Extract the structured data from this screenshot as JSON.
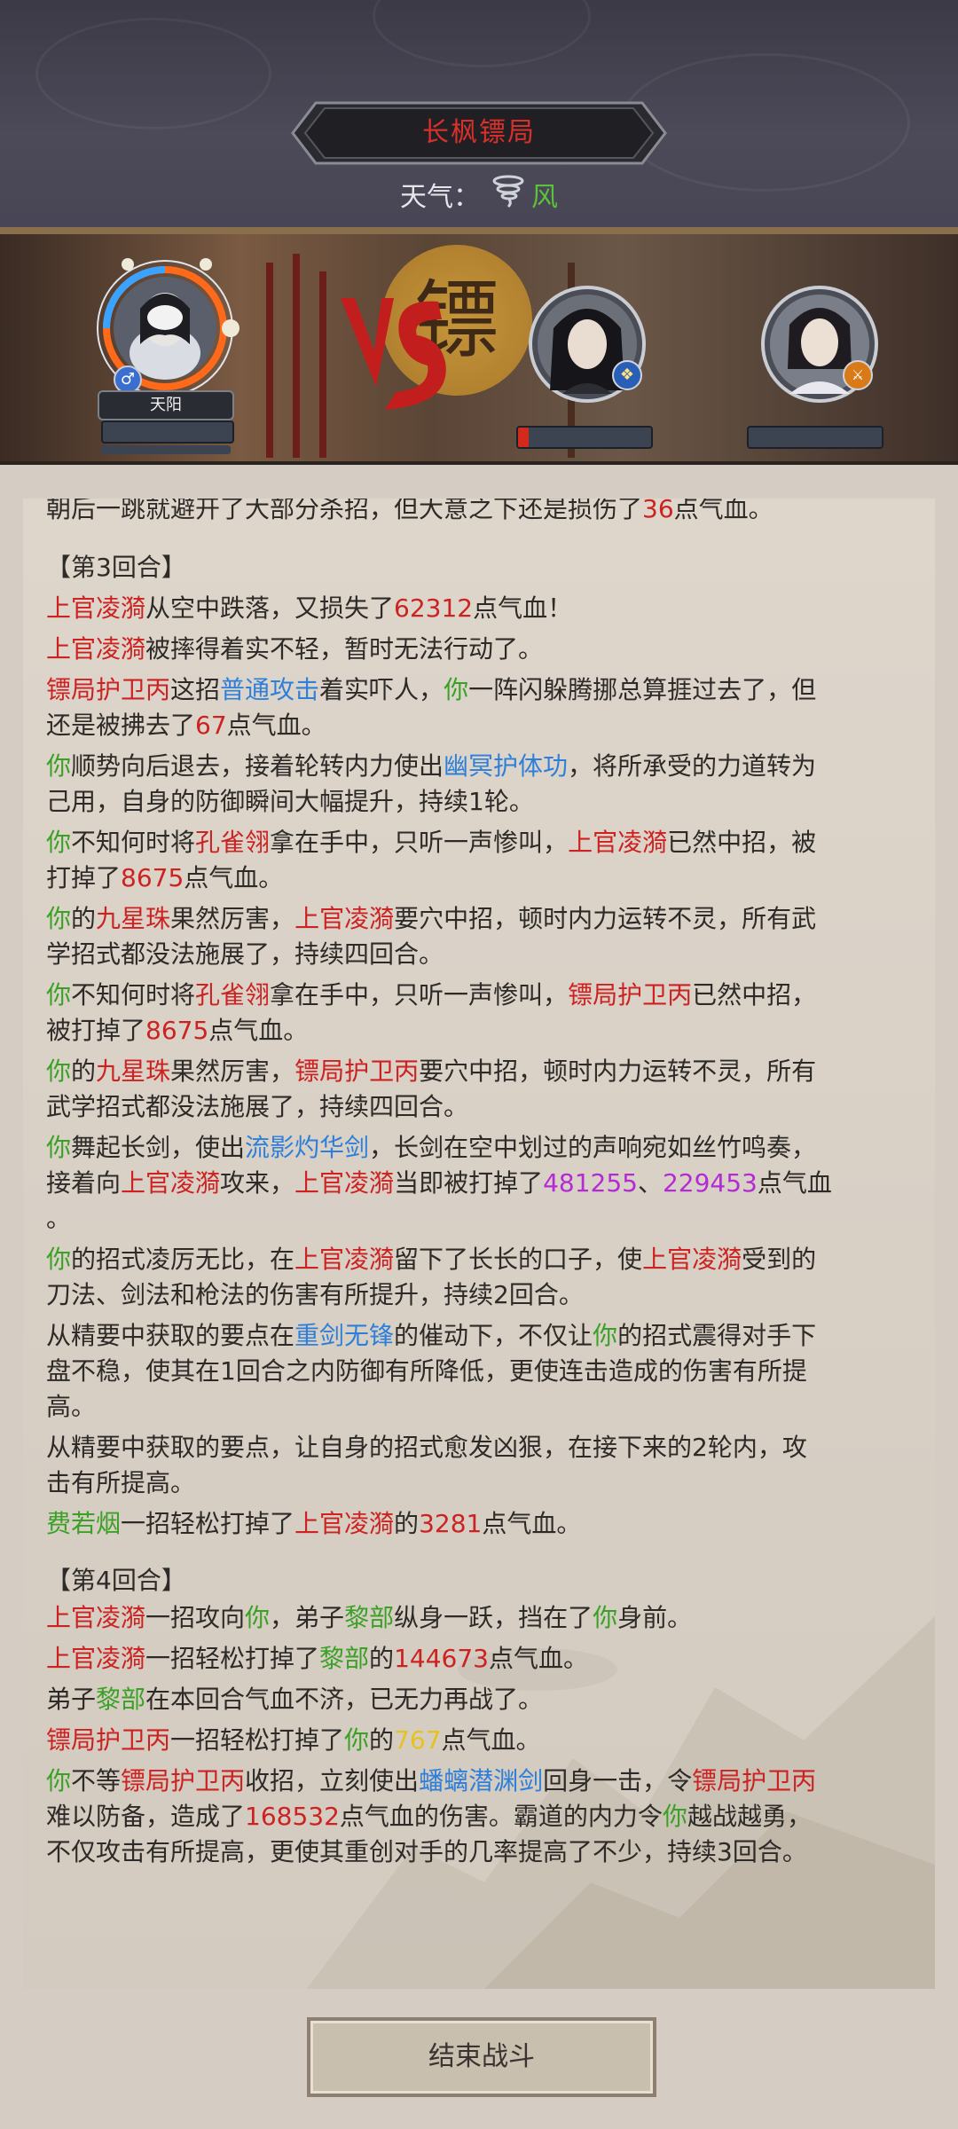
{
  "header": {
    "title": "长枫镖局",
    "weather_label": "天气：",
    "weather_value": "风",
    "weather_icon": "whirlwind-icon"
  },
  "battle": {
    "player_name": "天阳",
    "vs_label": "VS",
    "sign_char": "镖",
    "enemy1_hp_fraction": 0.08,
    "enemy2_hp_fraction": 0.0
  },
  "log": {
    "lines": [
      [
        {
          "t": "朝后一跳就避开了大部分杀招，但大意之下还是损伤了",
          "c": ""
        },
        {
          "t": "36",
          "c": "r"
        },
        {
          "t": "点气血。",
          "c": ""
        }
      ],
      [
        {
          "t": "【第3回合】",
          "c": ""
        }
      ],
      [
        {
          "t": "上官凌漪",
          "c": "r"
        },
        {
          "t": "从空中跌落，又损失了",
          "c": ""
        },
        {
          "t": "62312",
          "c": "r"
        },
        {
          "t": "点气血！",
          "c": ""
        }
      ],
      [
        {
          "t": "上官凌漪",
          "c": "r"
        },
        {
          "t": "被摔得着实不轻，暂时无法行动了。",
          "c": ""
        }
      ],
      [
        {
          "t": "镖局护卫丙",
          "c": "r"
        },
        {
          "t": "这招",
          "c": ""
        },
        {
          "t": "普通攻击",
          "c": "b"
        },
        {
          "t": "着实吓人，",
          "c": ""
        },
        {
          "t": "你",
          "c": "g"
        },
        {
          "t": "一阵闪躲腾挪总算捱过去了，但",
          "c": ""
        }
      ],
      [
        {
          "t": "还是被拂去了",
          "c": ""
        },
        {
          "t": "67",
          "c": "r"
        },
        {
          "t": "点气血。",
          "c": ""
        }
      ],
      [
        {
          "t": "你",
          "c": "g"
        },
        {
          "t": "顺势向后退去，接着轮转内力使出",
          "c": ""
        },
        {
          "t": "幽冥护体功",
          "c": "b"
        },
        {
          "t": "，将所承受的力道转为",
          "c": ""
        }
      ],
      [
        {
          "t": "己用，自身的防御瞬间大幅提升，持续1轮。",
          "c": ""
        }
      ],
      [
        {
          "t": "你",
          "c": "g"
        },
        {
          "t": "不知何时将",
          "c": ""
        },
        {
          "t": "孔雀翎",
          "c": "r"
        },
        {
          "t": "拿在手中，只听一声惨叫，",
          "c": ""
        },
        {
          "t": "上官凌漪",
          "c": "r"
        },
        {
          "t": "已然中招，被",
          "c": ""
        }
      ],
      [
        {
          "t": "打掉了",
          "c": ""
        },
        {
          "t": "8675",
          "c": "r"
        },
        {
          "t": "点气血。",
          "c": ""
        }
      ],
      [
        {
          "t": "你",
          "c": "g"
        },
        {
          "t": "的",
          "c": ""
        },
        {
          "t": "九星珠",
          "c": "r"
        },
        {
          "t": "果然厉害，",
          "c": ""
        },
        {
          "t": "上官凌漪",
          "c": "r"
        },
        {
          "t": "要穴中招，顿时内力运转不灵，所有武",
          "c": ""
        }
      ],
      [
        {
          "t": "学招式都没法施展了，持续四回合。",
          "c": ""
        }
      ],
      [
        {
          "t": "你",
          "c": "g"
        },
        {
          "t": "不知何时将",
          "c": ""
        },
        {
          "t": "孔雀翎",
          "c": "r"
        },
        {
          "t": "拿在手中，只听一声惨叫，",
          "c": ""
        },
        {
          "t": "镖局护卫丙",
          "c": "r"
        },
        {
          "t": "已然中招，",
          "c": ""
        }
      ],
      [
        {
          "t": "被打掉了",
          "c": ""
        },
        {
          "t": "8675",
          "c": "r"
        },
        {
          "t": "点气血。",
          "c": ""
        }
      ],
      [
        {
          "t": "你",
          "c": "g"
        },
        {
          "t": "的",
          "c": ""
        },
        {
          "t": "九星珠",
          "c": "r"
        },
        {
          "t": "果然厉害，",
          "c": ""
        },
        {
          "t": "镖局护卫丙",
          "c": "r"
        },
        {
          "t": "要穴中招，顿时内力运转不灵，所有",
          "c": ""
        }
      ],
      [
        {
          "t": "武学招式都没法施展了，持续四回合。",
          "c": ""
        }
      ],
      [
        {
          "t": "你",
          "c": "g"
        },
        {
          "t": "舞起长剑，使出",
          "c": ""
        },
        {
          "t": "流影灼华剑",
          "c": "b"
        },
        {
          "t": "，长剑在空中划过的声响宛如丝竹鸣奏，",
          "c": ""
        }
      ],
      [
        {
          "t": "接着向",
          "c": ""
        },
        {
          "t": "上官凌漪",
          "c": "r"
        },
        {
          "t": "攻来，",
          "c": ""
        },
        {
          "t": "上官凌漪",
          "c": "r"
        },
        {
          "t": "当即被打掉了",
          "c": ""
        },
        {
          "t": "481255",
          "c": "p"
        },
        {
          "t": "、",
          "c": ""
        },
        {
          "t": "229453",
          "c": "p"
        },
        {
          "t": "点气血",
          "c": ""
        }
      ],
      [
        {
          "t": "。",
          "c": ""
        }
      ],
      [
        {
          "t": "你",
          "c": "g"
        },
        {
          "t": "的招式凌厉无比，在",
          "c": ""
        },
        {
          "t": "上官凌漪",
          "c": "r"
        },
        {
          "t": "留下了长长的口子，使",
          "c": ""
        },
        {
          "t": "上官凌漪",
          "c": "r"
        },
        {
          "t": "受到的",
          "c": ""
        }
      ],
      [
        {
          "t": "刀法、剑法和枪法的伤害有所提升，持续2回合。",
          "c": ""
        }
      ],
      [
        {
          "t": "从精要中获取的要点在",
          "c": ""
        },
        {
          "t": "重剑无锋",
          "c": "b"
        },
        {
          "t": "的催动下，不仅让",
          "c": ""
        },
        {
          "t": "你",
          "c": "g"
        },
        {
          "t": "的招式震得对手下",
          "c": ""
        }
      ],
      [
        {
          "t": "盘不稳，使其在1回合之内防御有所降低，更使连击造成的伤害有所提",
          "c": ""
        }
      ],
      [
        {
          "t": "高。",
          "c": ""
        }
      ],
      [
        {
          "t": "从精要中获取的要点，让自身的招式愈发凶狠，在接下来的2轮内，攻",
          "c": ""
        }
      ],
      [
        {
          "t": "击有所提高。",
          "c": ""
        }
      ],
      [
        {
          "t": "费若烟",
          "c": "g"
        },
        {
          "t": "一招轻松打掉了",
          "c": ""
        },
        {
          "t": "上官凌漪",
          "c": "r"
        },
        {
          "t": "的",
          "c": ""
        },
        {
          "t": "3281",
          "c": "r"
        },
        {
          "t": "点气血。",
          "c": ""
        }
      ],
      [
        {
          "t": "【第4回合】",
          "c": ""
        }
      ],
      [
        {
          "t": "上官凌漪",
          "c": "r"
        },
        {
          "t": "一招攻向",
          "c": ""
        },
        {
          "t": "你",
          "c": "g"
        },
        {
          "t": "，弟子",
          "c": ""
        },
        {
          "t": "黎部",
          "c": "g"
        },
        {
          "t": "纵身一跃，挡在了",
          "c": ""
        },
        {
          "t": "你",
          "c": "g"
        },
        {
          "t": "身前。",
          "c": ""
        }
      ],
      [
        {
          "t": "上官凌漪",
          "c": "r"
        },
        {
          "t": "一招轻松打掉了",
          "c": ""
        },
        {
          "t": "黎部",
          "c": "g"
        },
        {
          "t": "的",
          "c": ""
        },
        {
          "t": "144673",
          "c": "r"
        },
        {
          "t": "点气血。",
          "c": ""
        }
      ],
      [
        {
          "t": "弟子",
          "c": ""
        },
        {
          "t": "黎部",
          "c": "g"
        },
        {
          "t": "在本回合气血不济，已无力再战了。",
          "c": ""
        }
      ],
      [
        {
          "t": "镖局护卫丙",
          "c": "r"
        },
        {
          "t": "一招轻松打掉了",
          "c": ""
        },
        {
          "t": "你",
          "c": "g"
        },
        {
          "t": "的",
          "c": ""
        },
        {
          "t": "767",
          "c": "y"
        },
        {
          "t": "点气血。",
          "c": ""
        }
      ],
      [
        {
          "t": "你",
          "c": "g"
        },
        {
          "t": "不等",
          "c": ""
        },
        {
          "t": "镖局护卫丙",
          "c": "r"
        },
        {
          "t": "收招，立刻使出",
          "c": ""
        },
        {
          "t": "蟠螭潜渊剑",
          "c": "b"
        },
        {
          "t": "回身一击，令",
          "c": ""
        },
        {
          "t": "镖局护卫丙",
          "c": "r"
        }
      ],
      [
        {
          "t": "难以防备，造成了",
          "c": ""
        },
        {
          "t": "168532",
          "c": "r"
        },
        {
          "t": "点气血的伤害。霸道的内力令",
          "c": ""
        },
        {
          "t": "你",
          "c": "g"
        },
        {
          "t": "越战越勇，",
          "c": ""
        }
      ],
      [
        {
          "t": "不仅攻击有所提高，更使其重创对手的几率提高了不少，持续3回合。",
          "c": ""
        }
      ]
    ]
  },
  "footer": {
    "end_button_label": "结束战斗"
  }
}
